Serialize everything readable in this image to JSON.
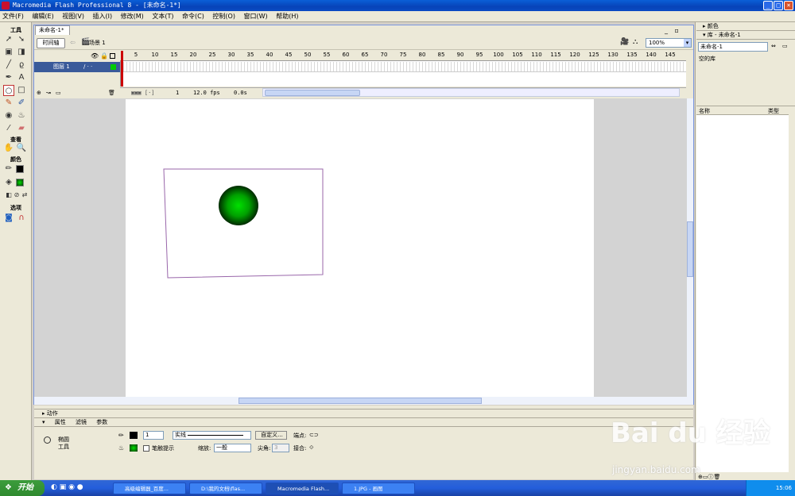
{
  "window": {
    "title": "Macromedia Flash Professional 8 - [未命名-1*]",
    "controls": [
      "_",
      "□",
      "×"
    ]
  },
  "menubar": [
    "文件(F)",
    "编辑(E)",
    "视图(V)",
    "插入(I)",
    "修改(M)",
    "文本(T)",
    "命令(C)",
    "控制(O)",
    "窗口(W)",
    "帮助(H)"
  ],
  "tools": {
    "header": "工具",
    "view_header": "查看",
    "colors_header": "颜色",
    "options_header": "选项"
  },
  "document": {
    "tab": "未命名-1*",
    "timeline_button": "时间轴",
    "scene": "场景 1",
    "zoom": "100%"
  },
  "timeline": {
    "layer_name": "图层 1",
    "ruler": [
      "5",
      "10",
      "15",
      "20",
      "25",
      "30",
      "35",
      "40",
      "45",
      "50",
      "55",
      "60",
      "65",
      "70",
      "75",
      "80",
      "85",
      "90",
      "95",
      "100",
      "105",
      "110",
      "115",
      "120",
      "125",
      "130",
      "135",
      "140",
      "145"
    ],
    "current_frame": "1",
    "fps": "12.0 fps",
    "time": "0.0s"
  },
  "panels": {
    "actions": "动作",
    "tabs": [
      "属性",
      "滤镜",
      "参数"
    ],
    "tool_name": "椭圆",
    "tool_sub": "工具",
    "stroke_width": "1",
    "stroke_style": "实线",
    "custom_button": "自定义...",
    "endpoint_label": "端点:",
    "hinting_label": "笔触提示",
    "scale_label": "缩放:",
    "scale_value": "一般",
    "miter_label": "尖角:",
    "miter_value": "3",
    "join_label": "接合:"
  },
  "right_panel": {
    "color_header": "颜色",
    "library_header": "库 - 未命名-1",
    "library_select": "未命名-1",
    "library_empty": "空的库",
    "col_name": "名称",
    "col_type": "类型"
  },
  "taskbar": {
    "start": "开始",
    "tasks": [
      "高级编辑器_百度...",
      "D:\\我的文档\\flas...",
      "Macromedia Flash...",
      "1.JPG - 画图"
    ],
    "clock": "15:06"
  },
  "watermark": {
    "logo": "Bai du 经验",
    "url": "jingyan.baidu.com"
  },
  "colors": {
    "xp_blue": "#0a5fd8",
    "ball_center": "#00e000",
    "ball_edge": "#003300",
    "rect_stroke": "#9966aa"
  }
}
